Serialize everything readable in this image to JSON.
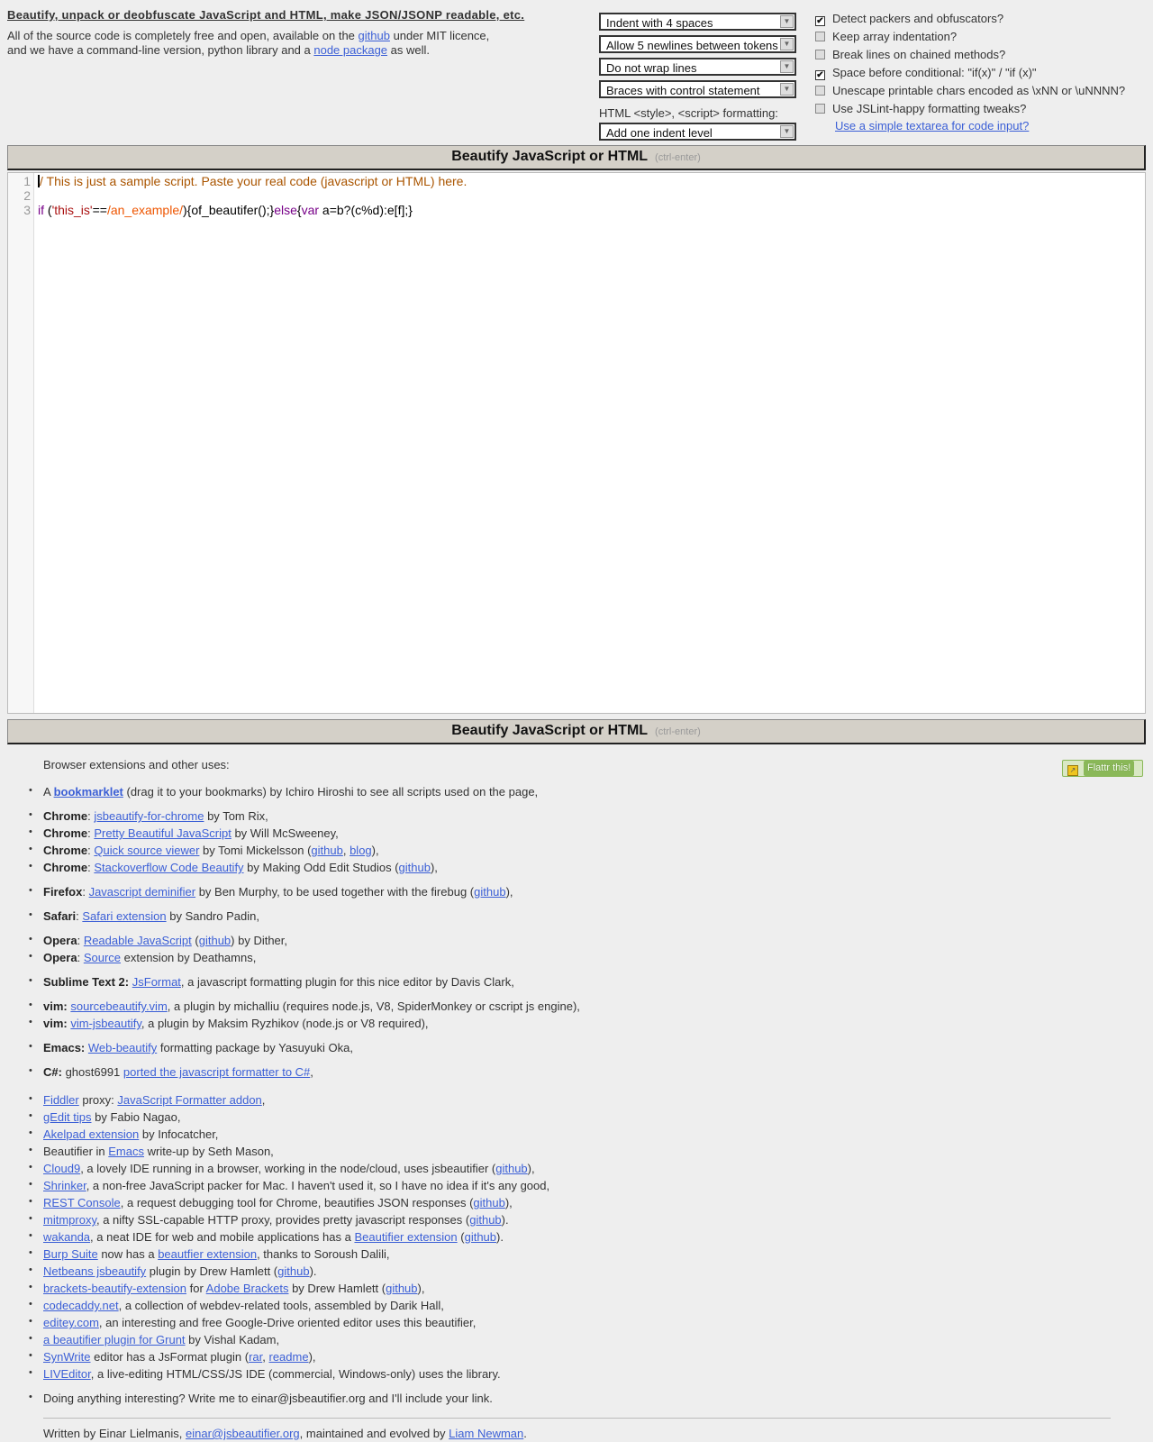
{
  "header": {
    "title": "Beautify, unpack or deobfuscate JavaScript and HTML, make JSON/JSONP readable, etc.",
    "intro": {
      "t1": "All of the source code is completely free and open, available on the ",
      "github": "github",
      "t2": " under MIT licence,",
      "t3": "and we have a command-line version, python library and a ",
      "node": "node package",
      "t4": " as well."
    }
  },
  "options": {
    "indent": "Indent with 4 spaces",
    "newlines": "Allow 5 newlines between tokens",
    "wrap": "Do not wrap lines",
    "braces": "Braces with control statement",
    "html_label": "HTML <style>, <script> formatting:",
    "html_indent": "Add one indent level"
  },
  "checkboxes": [
    {
      "label": "Detect packers and obfuscators?",
      "checked": true
    },
    {
      "label": "Keep array indentation?",
      "checked": false
    },
    {
      "label": "Break lines on chained methods?",
      "checked": false
    },
    {
      "label": "Space before conditional: \"if(x)\" / \"if (x)\"",
      "checked": true
    },
    {
      "label": "Unescape printable chars encoded as \\xNN or \\uNNNN?",
      "checked": false
    },
    {
      "label": "Use JSLint-happy formatting tweaks?",
      "checked": false
    }
  ],
  "textarea_link": "Use a simple textarea for code input?",
  "beautify_button": {
    "label": "Beautify JavaScript or HTML",
    "hint": "(ctrl-enter)"
  },
  "editor": {
    "line_numbers": [
      "1",
      "2",
      "3"
    ],
    "line1": "/ This is just a sample script. Paste your real code (javascript or HTML) here.",
    "line3": {
      "kw_if": "if",
      "p1": " (",
      "str": "'this_is'",
      "p2": "==",
      "re": "/an_example/",
      "p3": "){of_beautifer();}",
      "kw_else": "else",
      "p4": "{",
      "kw_var": "var",
      "p5": " a=b?(c%d):e[f];}"
    }
  },
  "flattr": "Flattr this!",
  "uses_heading": "Browser extensions and other uses:",
  "uses": {
    "bookmarklet": {
      "a": "A ",
      "link": "bookmarklet",
      "b": " (drag it to your bookmarks) by Ichiro Hiroshi to see all scripts used on the page,"
    },
    "chrome1": {
      "k": "Chrome",
      "sep": ": ",
      "link": "jsbeautify-for-chrome",
      "b": " by Tom Rix,"
    },
    "chrome2": {
      "k": "Chrome",
      "sep": ": ",
      "link": "Pretty Beautiful JavaScript",
      "b": " by Will McSweeney,"
    },
    "chrome3": {
      "k": "Chrome",
      "sep": ": ",
      "link": "Quick source viewer",
      "b": " by Tomi Mickelsson (",
      "l2": "github",
      "c": ", ",
      "l3": "blog",
      "d": "),"
    },
    "chrome4": {
      "k": "Chrome",
      "sep": ": ",
      "link": "Stackoverflow Code Beautify",
      "b": " by Making Odd Edit Studios (",
      "l2": "github",
      "d": "),"
    },
    "firefox": {
      "k": "Firefox",
      "sep": ": ",
      "link": "Javascript deminifier",
      "b": " by Ben Murphy, to be used together with the firebug (",
      "l2": "github",
      "d": "),"
    },
    "safari": {
      "k": "Safari",
      "sep": ": ",
      "link": "Safari extension",
      "b": " by Sandro Padin,"
    },
    "opera1": {
      "k": "Opera",
      "sep": ": ",
      "link": "Readable JavaScript",
      "b": " (",
      "l2": "github",
      "d": ") by Dither,"
    },
    "opera2": {
      "k": "Opera",
      "sep": ": ",
      "link": "Source",
      "b": " extension by Deathamns,"
    },
    "sublime": {
      "k": "Sublime Text 2:",
      "sep": " ",
      "link": "JsFormat",
      "b": ", a javascript formatting plugin for this nice editor by Davis Clark,"
    },
    "vim1": {
      "k": "vim:",
      "sep": " ",
      "link": "sourcebeautify.vim",
      "b": ", a plugin by michalliu (requires node.js, V8, SpiderMonkey or cscript js engine),"
    },
    "vim2": {
      "k": "vim:",
      "sep": " ",
      "link": "vim-jsbeautify",
      "b": ", a plugin by Maksim Ryzhikov (node.js or V8 required),"
    },
    "emacs": {
      "k": "Emacs:",
      "sep": " ",
      "link": "Web-beautify",
      "b": " formatting package by Yasuyuki Oka,"
    },
    "csharp": {
      "k": "C#:",
      "sep": " ghost6991 ",
      "link": "ported the javascript formatter to C#",
      "b": ","
    },
    "fiddler": {
      "link": "Fiddler",
      "b": " proxy: ",
      "l2": "JavaScript Formatter addon",
      "d": ","
    },
    "gedit": {
      "link": "gEdit tips",
      "b": " by Fabio Nagao,"
    },
    "akelpad": {
      "link": "Akelpad extension",
      "b": " by Infocatcher,"
    },
    "emacs2": {
      "a": "Beautifier in ",
      "link": "Emacs",
      "b": " write-up by Seth Mason,"
    },
    "cloud9": {
      "link": "Cloud9",
      "b": ", a lovely IDE running in a browser, working in the node/cloud, uses jsbeautifier (",
      "l2": "github",
      "d": "),"
    },
    "shrinker": {
      "link": "Shrinker",
      "b": ", a non-free JavaScript packer for Mac. I haven't used it, so I have no idea if it's any good,"
    },
    "rest": {
      "link": "REST Console",
      "b": ", a request debugging tool for Chrome, beautifies JSON responses (",
      "l2": "github",
      "d": "),"
    },
    "mitmproxy": {
      "link": "mitmproxy",
      "b": ", a nifty SSL-capable HTTP proxy, provides pretty javascript responses (",
      "l2": "github",
      "d": ")."
    },
    "wakanda": {
      "link": "wakanda",
      "b": ", a neat IDE for web and mobile applications has a ",
      "l2": "Beautifier extension",
      "c": " (",
      "l3": "github",
      "d": ")."
    },
    "burp": {
      "link": "Burp Suite",
      "b": " now has a ",
      "l2": "beautfier extension",
      "d": ", thanks to Soroush Dalili,"
    },
    "netbeans": {
      "link": "Netbeans jsbeautify",
      "b": " plugin by Drew Hamlett (",
      "l2": "github",
      "d": ")."
    },
    "brackets": {
      "link": "brackets-beautify-extension",
      "b": " for ",
      "l2": "Adobe Brackets",
      "c": " by Drew Hamlett (",
      "l3": "github",
      "d": "),"
    },
    "codecaddy": {
      "link": "codecaddy.net",
      "b": ", a collection of webdev-related tools, assembled by Darik Hall,"
    },
    "editey": {
      "link": "editey.com",
      "b": ", an interesting and free Google-Drive oriented editor uses this beautifier,"
    },
    "grunt": {
      "link": "a beautifier plugin for Grunt",
      "b": " by Vishal Kadam,"
    },
    "synwrite": {
      "link": "SynWrite",
      "b": " editor has a JsFormat plugin (",
      "l2": "rar",
      "c": ", ",
      "l3": "readme",
      "d": "),"
    },
    "liveditor": {
      "link": "LIVEditor",
      "b": ", a live-editing HTML/CSS/JS IDE (commercial, Windows-only) uses the library."
    },
    "anything": "Doing anything interesting? Write me to einar@jsbeautifier.org and I'll include your link."
  },
  "footer": {
    "a": "Written by Einar Lielmanis, ",
    "email": "einar@jsbeautifier.org",
    "b": ", maintained and evolved by ",
    "name": "Liam Newman",
    "c": "."
  }
}
